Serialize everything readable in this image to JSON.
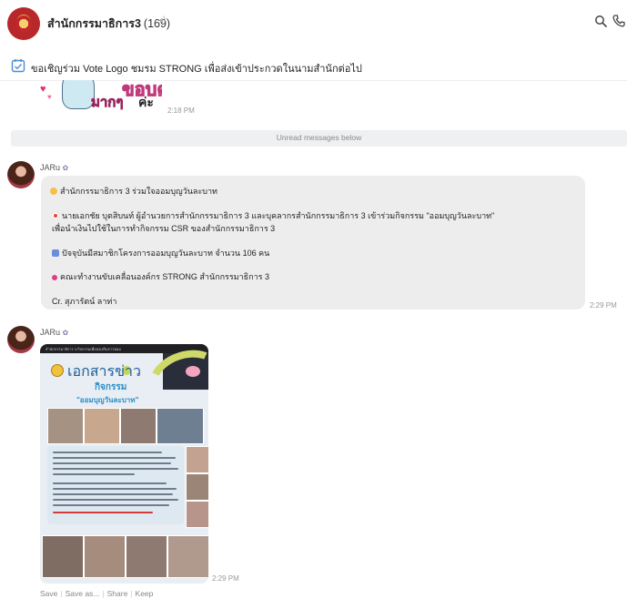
{
  "header": {
    "title": "สำนักกรรมาธิการ3",
    "member_count": "(169)",
    "mute_icon": "mute-icon",
    "search_icon": "search-icon",
    "call_icon": "phone-icon"
  },
  "announcement": {
    "icon": "checklist-icon",
    "text": "ขอเชิญร่วม Vote Logo ชมรม STRONG เพื่อส่งเข้าประกวดในนามสำนักต่อไป"
  },
  "sticker_message": {
    "sticker_text_line1": "ขอบคุณ",
    "sticker_text_line2": "มากๆ",
    "sticker_text_line3": "ค่ะ",
    "time": "2:18 PM"
  },
  "unread_divider": "Unread messages below",
  "messages": [
    {
      "sender": "JARu",
      "sender_emoji": "✿",
      "lines": [
        {
          "icon": "hand-icon",
          "icon_color": "#f5c04a",
          "text": "สำนักกรรมาธิการ 3 ร่วมใจออมบุญวันละบาท"
        },
        {
          "icon": "target-icon",
          "icon_color": "#e0463f",
          "text": "นายเอกชัย  บุตสิบนท์ ผู้อำนวยการสำนักกรรมาธิการ 3 และบุคลากรสำนักกรรมาธิการ 3 เข้าร่วมกิจกรรม \"ออมบุญวันละบาท\""
        },
        {
          "icon": "",
          "icon_color": "",
          "text": "เพื่อนำเงินไปใช้ในการทำกิจกรรม CSR ของสำนักกรรมาธิการ 3"
        },
        {
          "icon": "calendar-icon",
          "icon_color": "#6a8fd8",
          "text": "ปัจจุบันมีสมาชิกโครงการออมบุญวันละบาท  จำนวน 106 คน"
        },
        {
          "icon": "pin-icon",
          "icon_color": "#e23d8d",
          "text": "คณะทำงานขับเคลื่อนองค์กร STRONG สำนักกรรมาธิการ 3"
        },
        {
          "icon": "",
          "icon_color": "",
          "text": "Cr. สุภารัตน์ ลาท่า"
        }
      ],
      "time": "2:29 PM"
    },
    {
      "sender": "JARu",
      "sender_emoji": "✿",
      "image": {
        "title": "เอกสารข่าว",
        "subtitle": "กิจกรรม",
        "subtitle2": "\"ออมบุญวันละบาท\"",
        "top_caption": "สำนักกรรมาธิการ 3 กิจกรรมเพื่อส่งเสริมการออม"
      },
      "time": "2:29 PM",
      "actions": [
        "Save",
        "Save as...",
        "Share",
        "Keep"
      ]
    }
  ]
}
